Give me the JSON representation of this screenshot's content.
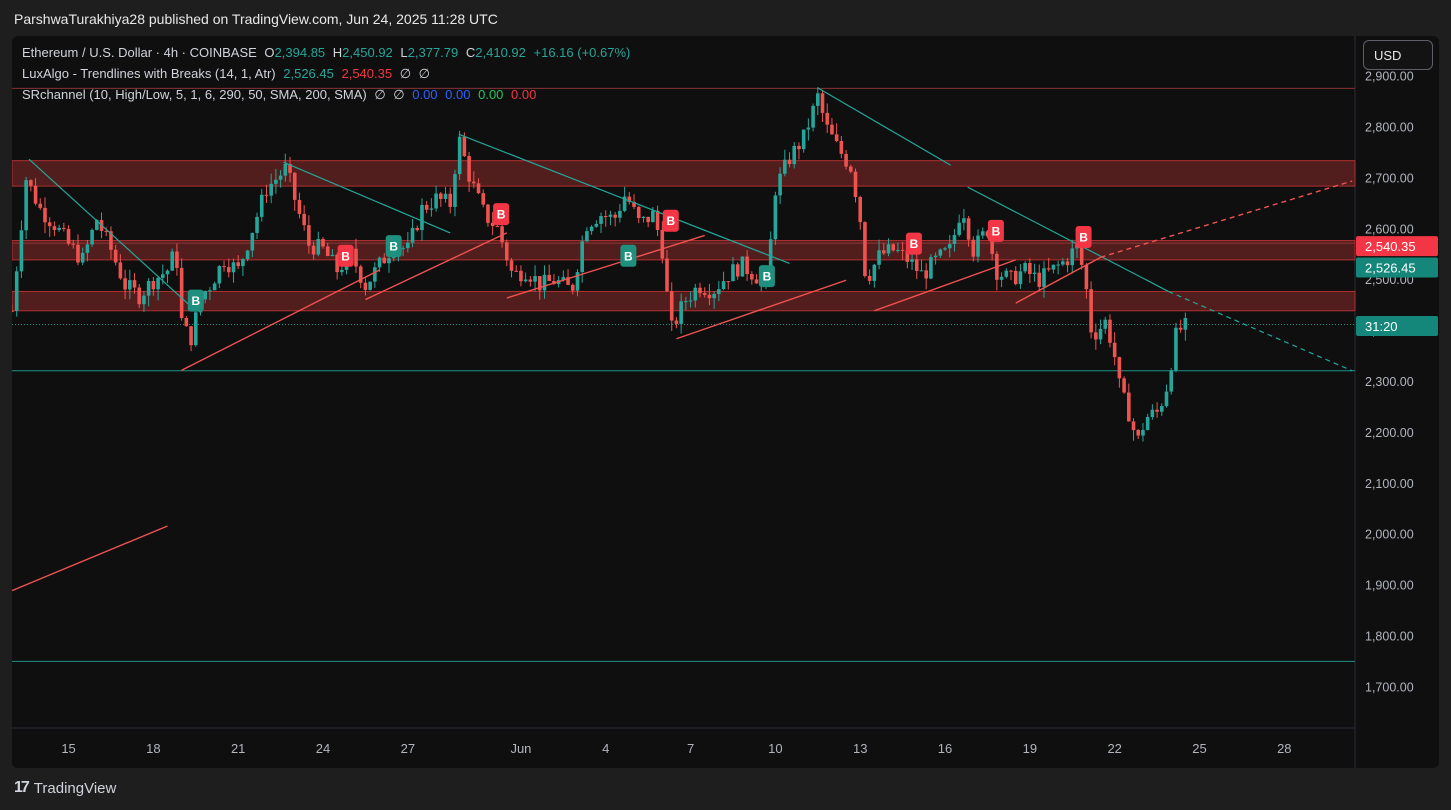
{
  "header": {
    "publish_line": "ParshwaTurakhiya28 published on TradingView.com, Jun 24, 2025 11:28 UTC"
  },
  "legend": {
    "symbol": "Ethereum / U.S. Dollar · 4h · COINBASE",
    "open_label": "O",
    "open": "2,394.85",
    "high_label": "H",
    "high": "2,450.92",
    "low_label": "L",
    "low": "2,377.79",
    "close_label": "C",
    "close": "2,410.92",
    "change": "+16.16 (+0.67%)",
    "lux_name": "LuxAlgo - Trendlines with Breaks (14, 1, Atr)",
    "lux_v1": "2,526.45",
    "lux_v2": "2,540.35",
    "lux_v3": "∅",
    "lux_v4": "∅",
    "sr_name": "SRchannel (10, High/Low, 5, 1, 6, 290, 50, SMA, 200, SMA)",
    "sr_v1": "∅",
    "sr_v2": "∅",
    "sr_v3": "0.00",
    "sr_v4": "0.00",
    "sr_v5": "0.00",
    "sr_v6": "0.00"
  },
  "currency_button": "USD",
  "brand": {
    "logo_glyph": "17",
    "name": "TradingView"
  },
  "colors": {
    "bull": "#26a69a",
    "bear": "#ef5350",
    "resistance_zone": "#8b2a2a",
    "teal_line": "#22a89a",
    "red_line": "#ef5350",
    "label_red": "#f23645",
    "label_green": "#1f8f7e"
  },
  "chart_data": {
    "type": "candlestick",
    "symbol": "ETH/USD",
    "interval": "4h",
    "x_ticks": [
      {
        "day": 15,
        "label": "15"
      },
      {
        "day": 18,
        "label": "18"
      },
      {
        "day": 21,
        "label": "21"
      },
      {
        "day": 24,
        "label": "24"
      },
      {
        "day": 27,
        "label": "27"
      },
      {
        "day": 31,
        "label": "Jun"
      },
      {
        "day": 34,
        "label": "4"
      },
      {
        "day": 37,
        "label": "7"
      },
      {
        "day": 40,
        "label": "10"
      },
      {
        "day": 43,
        "label": "13"
      },
      {
        "day": 46,
        "label": "16"
      },
      {
        "day": 49,
        "label": "19"
      },
      {
        "day": 52,
        "label": "22"
      },
      {
        "day": 55,
        "label": "25"
      },
      {
        "day": 58,
        "label": "28"
      }
    ],
    "x_range_days": [
      13,
      60.5
    ],
    "y_ticks": [
      1700,
      1800,
      1900,
      2000,
      2100,
      2200,
      2300,
      2400,
      2500,
      2600,
      2700,
      2800,
      2900
    ],
    "y_tick_labels": [
      "1,700.00",
      "1,800.00",
      "1,900.00",
      "2,000.00",
      "2,100.00",
      "2,200.00",
      "2,300.00",
      "2,400.00",
      "2,500.00",
      "2,600.00",
      "2,700.00",
      "2,800.00",
      "2,900.00"
    ],
    "ylim": [
      1620,
      2980
    ],
    "price_path": [
      {
        "day": 13.0,
        "close": 2440
      },
      {
        "day": 13.5,
        "close": 2700
      },
      {
        "day": 14.0,
        "close": 2640
      },
      {
        "day": 14.5,
        "close": 2610
      },
      {
        "day": 15.0,
        "close": 2570
      },
      {
        "day": 15.5,
        "close": 2540
      },
      {
        "day": 16.0,
        "close": 2620
      },
      {
        "day": 16.5,
        "close": 2560
      },
      {
        "day": 17.0,
        "close": 2490
      },
      {
        "day": 17.5,
        "close": 2470
      },
      {
        "day": 18.0,
        "close": 2500
      },
      {
        "day": 18.5,
        "close": 2520
      },
      {
        "day": 18.8,
        "close": 2560
      },
      {
        "day": 19.0,
        "close": 2420
      },
      {
        "day": 19.3,
        "close": 2380
      },
      {
        "day": 19.7,
        "close": 2470
      },
      {
        "day": 20.0,
        "close": 2490
      },
      {
        "day": 20.5,
        "close": 2540
      },
      {
        "day": 21.0,
        "close": 2520
      },
      {
        "day": 21.5,
        "close": 2600
      },
      {
        "day": 22.0,
        "close": 2680
      },
      {
        "day": 22.7,
        "close": 2720
      },
      {
        "day": 23.1,
        "close": 2640
      },
      {
        "day": 23.5,
        "close": 2570
      },
      {
        "day": 24.0,
        "close": 2560
      },
      {
        "day": 24.5,
        "close": 2520
      },
      {
        "day": 25.0,
        "close": 2550
      },
      {
        "day": 25.5,
        "close": 2490
      },
      {
        "day": 26.0,
        "close": 2530
      },
      {
        "day": 26.5,
        "close": 2570
      },
      {
        "day": 27.0,
        "close": 2560
      },
      {
        "day": 27.5,
        "close": 2640
      },
      {
        "day": 28.0,
        "close": 2660
      },
      {
        "day": 28.5,
        "close": 2650
      },
      {
        "day": 28.8,
        "close": 2780
      },
      {
        "day": 29.2,
        "close": 2700
      },
      {
        "day": 29.7,
        "close": 2630
      },
      {
        "day": 30.2,
        "close": 2600
      },
      {
        "day": 30.7,
        "close": 2510
      },
      {
        "day": 31.2,
        "close": 2520
      },
      {
        "day": 31.7,
        "close": 2490
      },
      {
        "day": 32.2,
        "close": 2500
      },
      {
        "day": 32.8,
        "close": 2480
      },
      {
        "day": 33.3,
        "close": 2610
      },
      {
        "day": 33.8,
        "close": 2630
      },
      {
        "day": 34.3,
        "close": 2620
      },
      {
        "day": 34.7,
        "close": 2670
      },
      {
        "day": 35.2,
        "close": 2610
      },
      {
        "day": 35.7,
        "close": 2630
      },
      {
        "day": 36.0,
        "close": 2560
      },
      {
        "day": 36.3,
        "close": 2400
      },
      {
        "day": 36.8,
        "close": 2460
      },
      {
        "day": 37.3,
        "close": 2490
      },
      {
        "day": 37.8,
        "close": 2480
      },
      {
        "day": 38.3,
        "close": 2510
      },
      {
        "day": 38.8,
        "close": 2530
      },
      {
        "day": 39.3,
        "close": 2510
      },
      {
        "day": 39.7,
        "close": 2490
      },
      {
        "day": 40.0,
        "close": 2680
      },
      {
        "day": 40.5,
        "close": 2740
      },
      {
        "day": 41.0,
        "close": 2780
      },
      {
        "day": 41.5,
        "close": 2860
      },
      {
        "day": 41.8,
        "close": 2800
      },
      {
        "day": 42.2,
        "close": 2760
      },
      {
        "day": 42.7,
        "close": 2720
      },
      {
        "day": 43.0,
        "close": 2620
      },
      {
        "day": 43.2,
        "close": 2500
      },
      {
        "day": 43.7,
        "close": 2550
      },
      {
        "day": 44.2,
        "close": 2560
      },
      {
        "day": 44.7,
        "close": 2540
      },
      {
        "day": 45.2,
        "close": 2510
      },
      {
        "day": 45.7,
        "close": 2540
      },
      {
        "day": 46.2,
        "close": 2560
      },
      {
        "day": 46.6,
        "close": 2650
      },
      {
        "day": 47.0,
        "close": 2560
      },
      {
        "day": 47.5,
        "close": 2600
      },
      {
        "day": 47.8,
        "close": 2520
      },
      {
        "day": 48.3,
        "close": 2500
      },
      {
        "day": 48.8,
        "close": 2520
      },
      {
        "day": 49.3,
        "close": 2500
      },
      {
        "day": 49.8,
        "close": 2520
      },
      {
        "day": 50.3,
        "close": 2540
      },
      {
        "day": 50.7,
        "close": 2570
      },
      {
        "day": 51.0,
        "close": 2480
      },
      {
        "day": 51.2,
        "close": 2390
      },
      {
        "day": 51.7,
        "close": 2420
      },
      {
        "day": 52.0,
        "close": 2350
      },
      {
        "day": 52.2,
        "close": 2280
      },
      {
        "day": 52.5,
        "close": 2240
      },
      {
        "day": 52.8,
        "close": 2180
      },
      {
        "day": 53.1,
        "close": 2230
      },
      {
        "day": 53.5,
        "close": 2240
      },
      {
        "day": 53.8,
        "close": 2280
      },
      {
        "day": 54.0,
        "close": 2340
      },
      {
        "day": 54.2,
        "close": 2400
      },
      {
        "day": 54.6,
        "close": 2410.92
      }
    ],
    "resistance_zones": [
      [
        2685,
        2735
      ],
      [
        2540,
        2578
      ],
      [
        2440,
        2478
      ]
    ],
    "horizontal_lines": [
      2877,
      2573,
      2413,
      2322,
      1751
    ],
    "trendlines_teal": [
      {
        "x1": 13.6,
        "y1": 2738,
        "x2": 19.5,
        "y2": 2440
      },
      {
        "x1": 22.6,
        "y1": 2732,
        "x2": 28.5,
        "y2": 2593
      },
      {
        "x1": 28.8,
        "y1": 2787,
        "x2": 40.5,
        "y2": 2533
      },
      {
        "x1": 41.5,
        "y1": 2878,
        "x2": 46.2,
        "y2": 2726
      },
      {
        "x1": 46.8,
        "y1": 2683,
        "x2": 53.9,
        "y2": 2478
      },
      {
        "x1": 53.9,
        "y1": 2478,
        "x2": 60.4,
        "y2": 2322,
        "dashed": true
      }
    ],
    "trendlines_red": [
      {
        "x1": 19.0,
        "y1": 2323,
        "x2": 26.0,
        "y2": 2520
      },
      {
        "x1": 25.5,
        "y1": 2462,
        "x2": 30.5,
        "y2": 2593
      },
      {
        "x1": 30.5,
        "y1": 2465,
        "x2": 37.5,
        "y2": 2588
      },
      {
        "x1": 36.5,
        "y1": 2385,
        "x2": 42.5,
        "y2": 2500
      },
      {
        "x1": 43.5,
        "y1": 2440,
        "x2": 48.5,
        "y2": 2540
      },
      {
        "x1": 48.5,
        "y1": 2455,
        "x2": 51.5,
        "y2": 2545
      },
      {
        "x1": 51.5,
        "y1": 2545,
        "x2": 60.4,
        "y2": 2695,
        "dashed": true
      },
      {
        "x1": 13.0,
        "y1": 1890,
        "x2": 18.5,
        "y2": 2017
      }
    ],
    "break_labels": [
      {
        "day": 19.5,
        "price": 2460,
        "text": "B",
        "kind": "bull"
      },
      {
        "day": 26.5,
        "price": 2567,
        "text": "B",
        "kind": "bull"
      },
      {
        "day": 34.8,
        "price": 2548,
        "text": "B",
        "kind": "bull"
      },
      {
        "day": 39.7,
        "price": 2508,
        "text": "B",
        "kind": "bull"
      },
      {
        "day": 24.8,
        "price": 2548,
        "text": "B",
        "kind": "bear"
      },
      {
        "day": 30.3,
        "price": 2630,
        "text": "B",
        "kind": "bear"
      },
      {
        "day": 36.3,
        "price": 2617,
        "text": "B",
        "kind": "bear"
      },
      {
        "day": 44.9,
        "price": 2572,
        "text": "B",
        "kind": "bear"
      },
      {
        "day": 47.8,
        "price": 2597,
        "text": "B",
        "kind": "bear"
      },
      {
        "day": 50.9,
        "price": 2585,
        "text": "B",
        "kind": "bear"
      }
    ],
    "price_labels": [
      {
        "price": 2567,
        "text": "2,540.35",
        "kind": "bear"
      },
      {
        "price": 2525,
        "text": "2,526.45",
        "kind": "bull"
      },
      {
        "price": 2410,
        "text": "31:20",
        "kind": "bull"
      }
    ]
  }
}
